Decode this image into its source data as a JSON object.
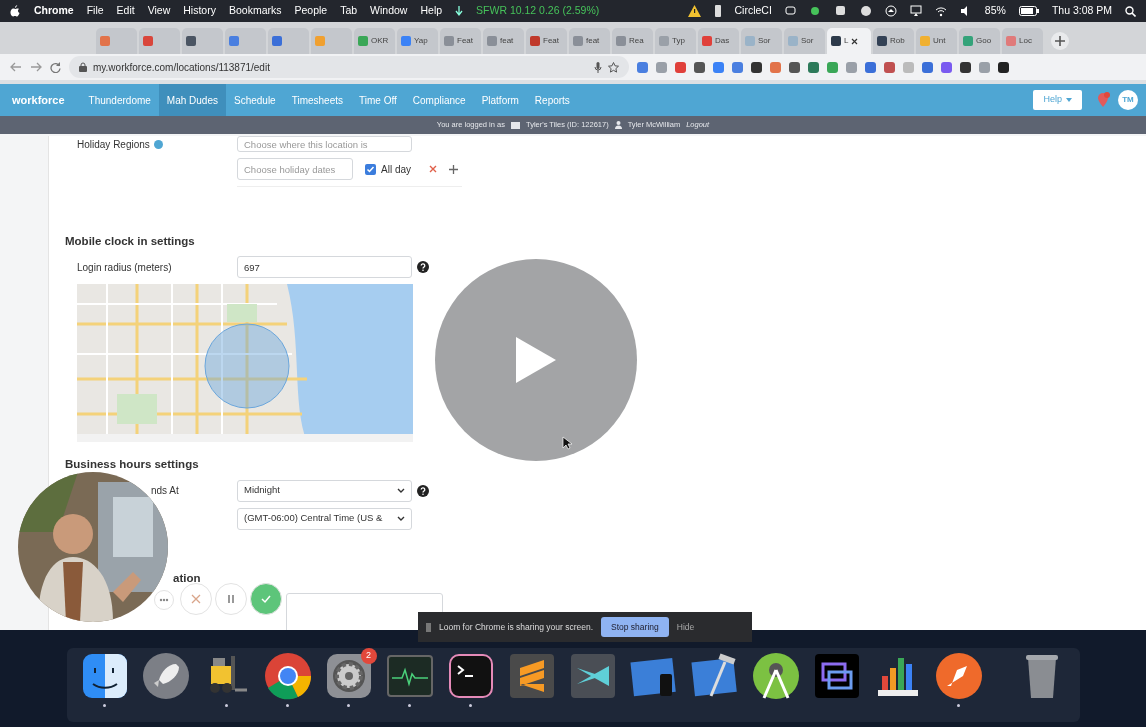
{
  "menu_bar": {
    "app": "Chrome",
    "menus": [
      "File",
      "Edit",
      "View",
      "History",
      "Bookmarks",
      "People",
      "Tab",
      "Window",
      "Help"
    ],
    "status": "SFWR 10.12 0.26 (2.59%)",
    "circleci": "CircleCI",
    "battery": "85%",
    "clock": "Thu 3:08 PM"
  },
  "tabs": [
    {
      "color": "#e2734a",
      "selected": false
    },
    {
      "color": "#d9463b",
      "selected": false
    },
    {
      "color": "#4b5563",
      "selected": false
    },
    {
      "color": "#4a7fe0",
      "selected": false
    },
    {
      "color": "#3b6fd8",
      "selected": false
    },
    {
      "color": "#f0a030",
      "selected": false
    },
    {
      "label": "OKR",
      "color": "#3aa757",
      "selected": false
    },
    {
      "label": "Yap",
      "color": "#3b82f6",
      "selected": false
    },
    {
      "label": "Feat",
      "color": "#8a8f98",
      "selected": false
    },
    {
      "label": "feat",
      "color": "#8a8f98",
      "selected": false
    },
    {
      "label": "Feat",
      "color": "#c0392b",
      "selected": false
    },
    {
      "label": "feat",
      "color": "#8a8f98",
      "selected": false
    },
    {
      "label": "Rea",
      "color": "#8a8f98",
      "selected": false
    },
    {
      "label": "Typ",
      "color": "#9aa0a8",
      "selected": false
    },
    {
      "label": "Das",
      "color": "#e0403a",
      "selected": false
    },
    {
      "label": "Sor",
      "color": "#9ab3c8",
      "selected": false
    },
    {
      "label": "Sor",
      "color": "#9ab3c8",
      "selected": false
    },
    {
      "label": "L",
      "color": "#2d3a4a",
      "selected": true
    },
    {
      "label": "Rob",
      "color": "#334155",
      "selected": false
    },
    {
      "label": "Unt",
      "color": "#f0b030",
      "selected": false
    },
    {
      "label": "Goo",
      "color": "#34a37a",
      "selected": false
    },
    {
      "label": "Loc",
      "color": "#e07a7a",
      "selected": false
    }
  ],
  "address": "my.workforce.com/locations/113871/edit",
  "extensions": [
    {
      "color": "#4a7fe0"
    },
    {
      "color": "#9aa0a8"
    },
    {
      "color": "#e0403a"
    },
    {
      "color": "#555555"
    },
    {
      "color": "#3b82f6"
    },
    {
      "color": "#4a7fe0"
    },
    {
      "color": "#333333"
    },
    {
      "color": "#e2734a"
    },
    {
      "color": "#555555"
    },
    {
      "color": "#2d7a5a"
    },
    {
      "color": "#3aa757"
    },
    {
      "color": "#9aa0a8"
    },
    {
      "color": "#3b6fd8"
    },
    {
      "color": "#c05050"
    },
    {
      "color": "#bbbbbb"
    },
    {
      "color": "#3b6fd8"
    },
    {
      "color": "#7a5af0"
    },
    {
      "color": "#333333"
    },
    {
      "color": "#9aa0a8"
    },
    {
      "color": "#222222"
    }
  ],
  "app_nav": {
    "brand": "workforce",
    "items": [
      {
        "label": "Thunderdome",
        "selected": false
      },
      {
        "label": "Mah Dudes",
        "selected": true
      },
      {
        "label": "Schedule",
        "selected": false
      },
      {
        "label": "Timesheets",
        "selected": false
      },
      {
        "label": "Time Off",
        "selected": false
      },
      {
        "label": "Compliance",
        "selected": false
      },
      {
        "label": "Platform",
        "selected": false
      },
      {
        "label": "Reports",
        "selected": false
      }
    ],
    "help": "Help",
    "avatar": "TM"
  },
  "session_bar": {
    "prefix": "You are logged in as",
    "account": "Tyler's Tiles (ID: 122617)",
    "user": "Tyler McWilliam",
    "logout": "Logout"
  },
  "holiday": {
    "label": "Holiday Regions",
    "region_placeholder": "Choose where this location is",
    "dates_placeholder": "Choose holiday dates",
    "all_day": {
      "label": "All day",
      "checked": true
    }
  },
  "mobile": {
    "heading": "Mobile clock in settings",
    "radius_label": "Login radius (meters)",
    "radius_value": "697"
  },
  "business": {
    "heading": "Business hours settings",
    "day_ends_label": "nds At",
    "day_ends_value": "Midnight",
    "timezone_value": "(GMT-06:00) Central Time (US &"
  },
  "next_heading": "ation",
  "loom": {
    "message": "Loom for Chrome is sharing your screen.",
    "stop": "Stop sharing",
    "hide": "Hide"
  },
  "dock": [
    {
      "running": true
    },
    {
      "running": false
    },
    {
      "running": true
    },
    {
      "running": true
    },
    {
      "running": true,
      "badge": "2"
    },
    {
      "running": true
    },
    {
      "running": true
    },
    {
      "running": false
    },
    {
      "running": false
    },
    {
      "running": false
    },
    {
      "running": false
    },
    {
      "running": false
    },
    {
      "running": false
    },
    {
      "running": false
    },
    {
      "running": true
    },
    {
      "running": false
    }
  ]
}
